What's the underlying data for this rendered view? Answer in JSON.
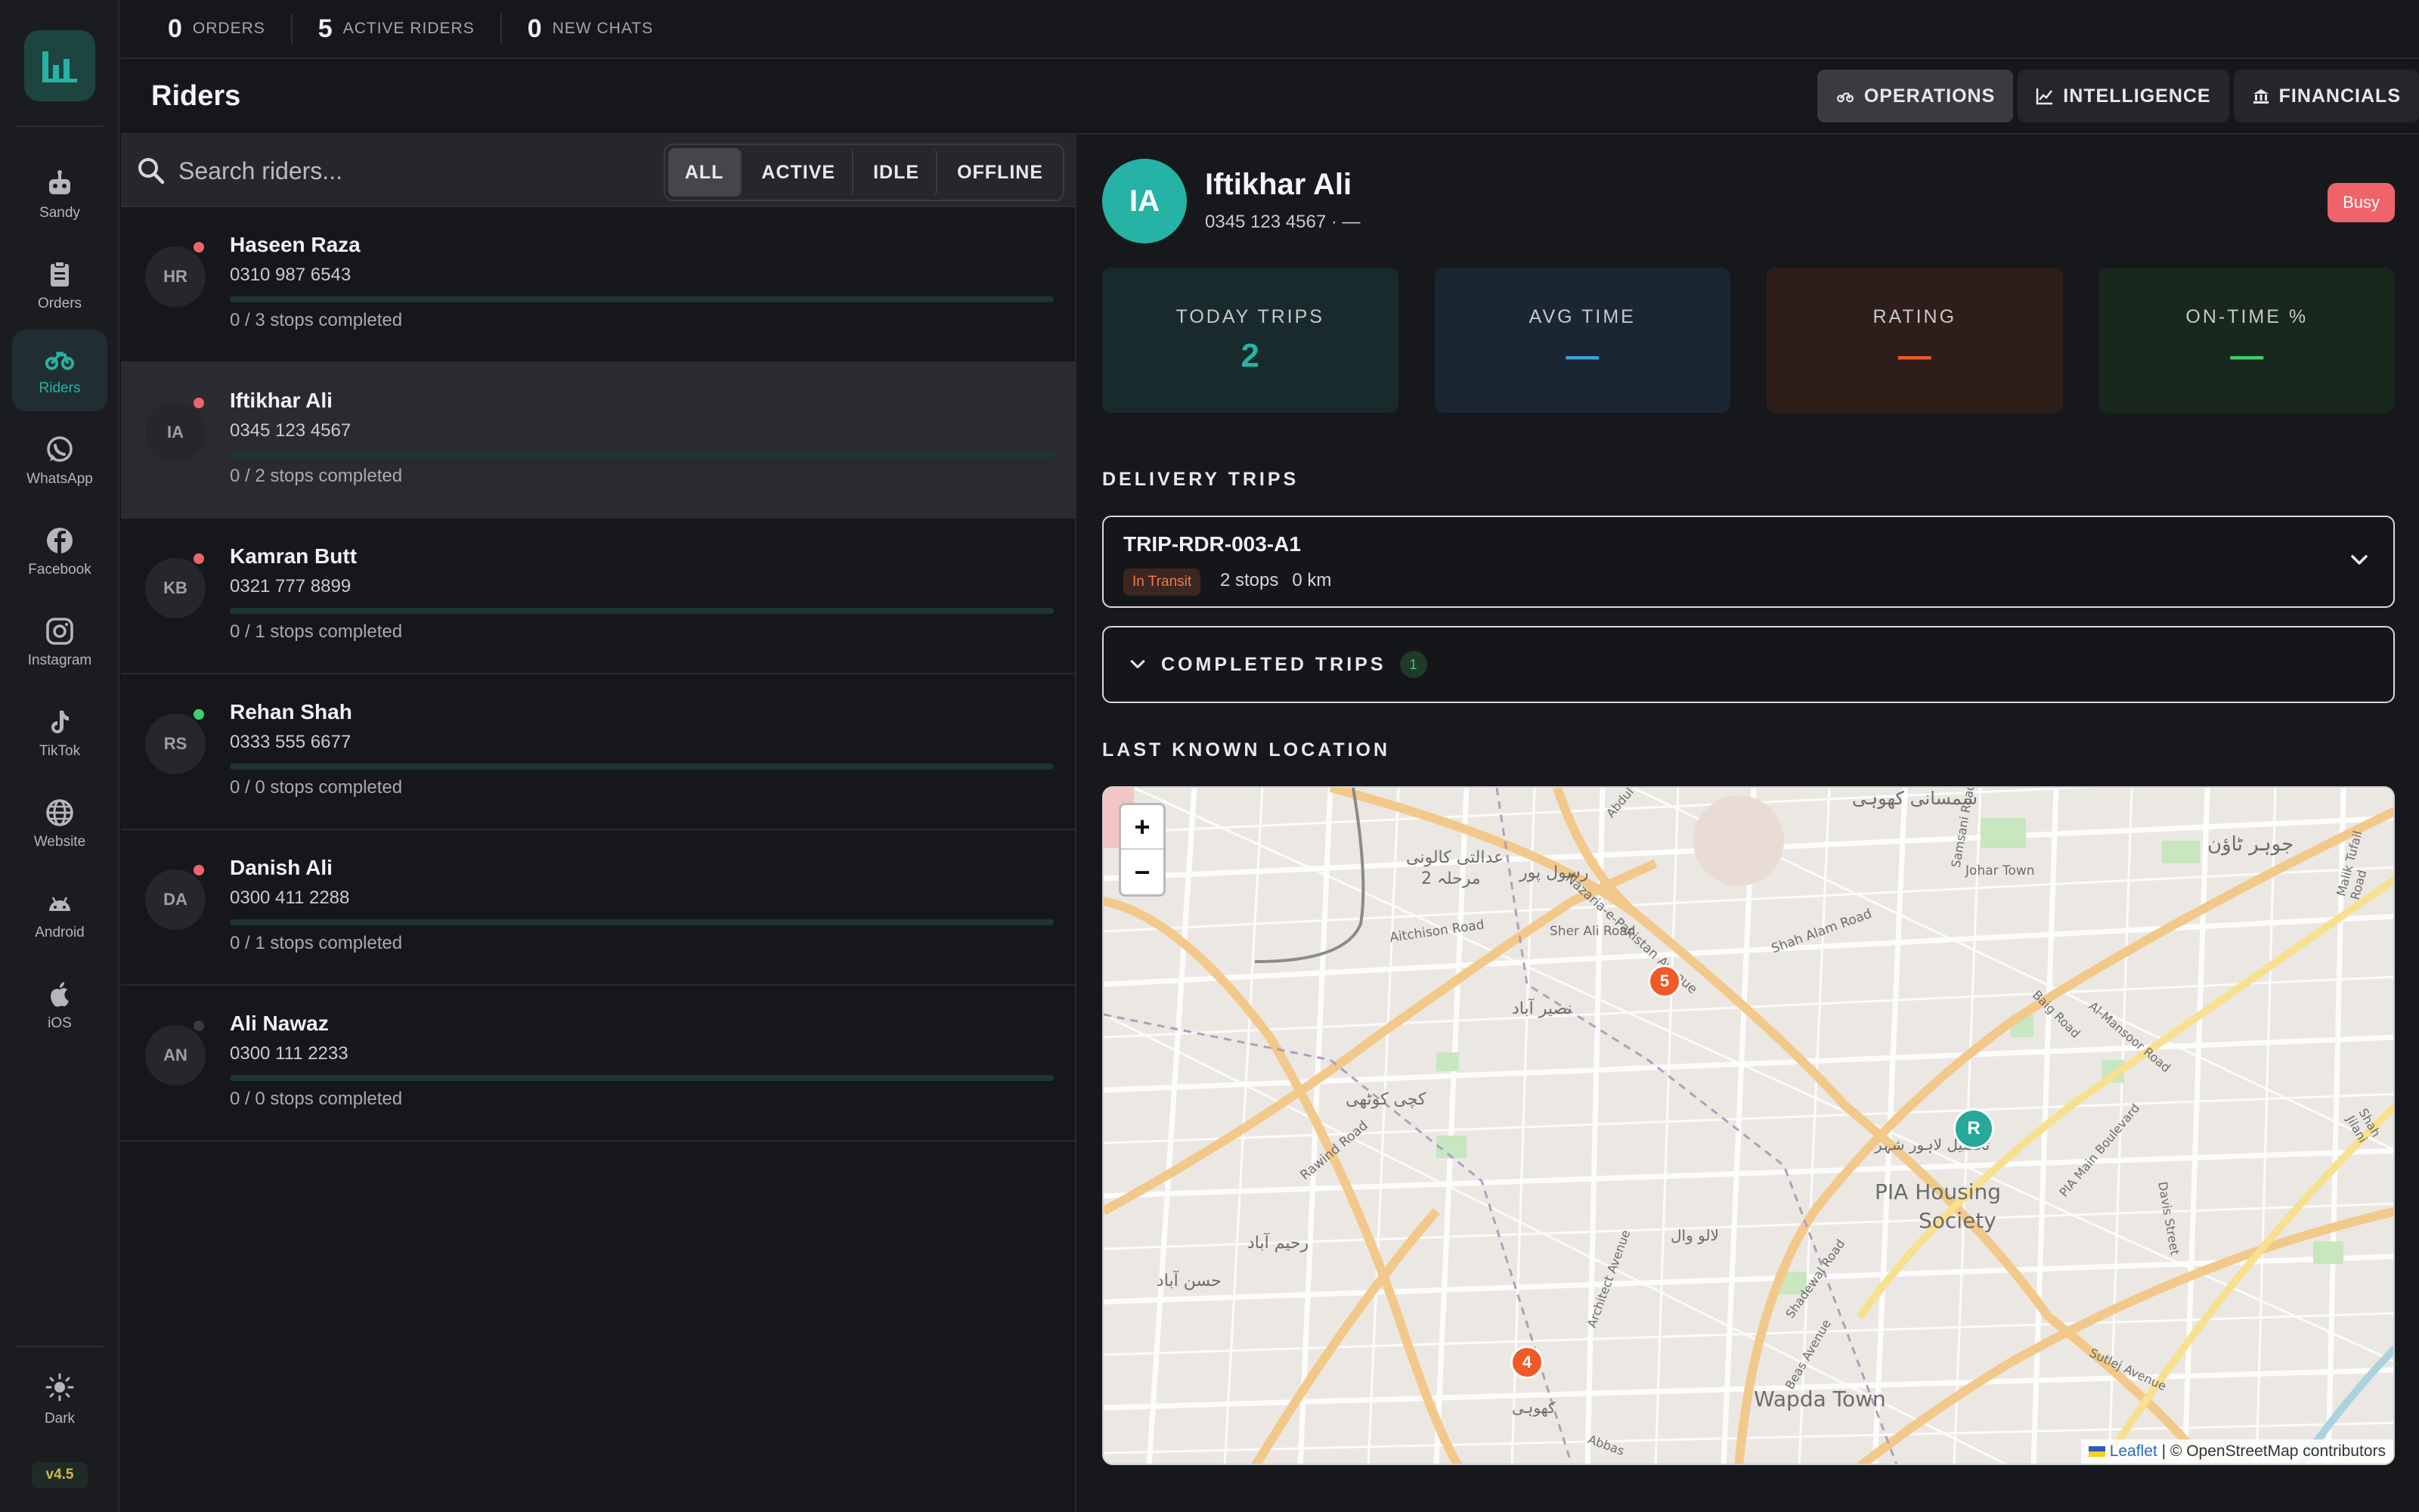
{
  "sidebar": {
    "items": [
      {
        "label": "Sandy",
        "icon": "robot-icon"
      },
      {
        "label": "Orders",
        "icon": "clipboard-icon"
      },
      {
        "label": "Riders",
        "icon": "motorbike-icon"
      },
      {
        "label": "WhatsApp",
        "icon": "whatsapp-icon"
      },
      {
        "label": "Facebook",
        "icon": "facebook-icon"
      },
      {
        "label": "Instagram",
        "icon": "instagram-icon"
      },
      {
        "label": "TikTok",
        "icon": "tiktok-icon"
      },
      {
        "label": "Website",
        "icon": "globe-icon"
      },
      {
        "label": "Android",
        "icon": "android-icon"
      },
      {
        "label": "iOS",
        "icon": "apple-icon"
      }
    ],
    "active": "Riders",
    "theme_label": "Dark",
    "version": "v4.5"
  },
  "topbar": {
    "stats": [
      {
        "value": "0",
        "label": "ORDERS"
      },
      {
        "value": "5",
        "label": "ACTIVE RIDERS"
      },
      {
        "value": "0",
        "label": "NEW CHATS"
      }
    ]
  },
  "header": {
    "title": "Riders",
    "tabs": [
      {
        "label": "OPERATIONS",
        "icon": "motorbike-icon"
      },
      {
        "label": "INTELLIGENCE",
        "icon": "line-chart-icon"
      },
      {
        "label": "FINANCIALS",
        "icon": "bank-icon"
      }
    ],
    "active_tab": "OPERATIONS"
  },
  "riders_list": {
    "search_placeholder": "Search riders...",
    "filters": [
      "ALL",
      "ACTIVE",
      "IDLE",
      "OFFLINE"
    ],
    "active_filter": "ALL",
    "riders": [
      {
        "initials": "HR",
        "name": "Haseen Raza",
        "phone": "0310 987 6543",
        "stops": "0 / 3 stops completed",
        "status": "busy",
        "progress": 0
      },
      {
        "initials": "IA",
        "name": "Iftikhar Ali",
        "phone": "0345 123 4567",
        "stops": "0 / 2 stops completed",
        "status": "busy",
        "progress": 0
      },
      {
        "initials": "KB",
        "name": "Kamran Butt",
        "phone": "0321 777 8899",
        "stops": "0 / 1 stops completed",
        "status": "busy",
        "progress": 0
      },
      {
        "initials": "RS",
        "name": "Rehan Shah",
        "phone": "0333 555 6677",
        "stops": "0 / 0 stops completed",
        "status": "active",
        "progress": 0
      },
      {
        "initials": "DA",
        "name": "Danish Ali",
        "phone": "0300 411 2288",
        "stops": "0 / 1 stops completed",
        "status": "busy",
        "progress": 0
      },
      {
        "initials": "AN",
        "name": "Ali Nawaz",
        "phone": "0300 111 2233",
        "stops": "0 / 0 stops completed",
        "status": "offline",
        "progress": 0
      }
    ],
    "selected_index": 1
  },
  "detail": {
    "initials": "IA",
    "name": "Iftikhar Ali",
    "phone_line": "0345 123 4567 · —",
    "status_badge": "Busy",
    "kpis": [
      {
        "label": "TODAY TRIPS",
        "value": "2",
        "color": "#26b3a5",
        "bg": "#182a2c"
      },
      {
        "label": "AVG TIME",
        "value": "—",
        "color": "#3ea2e0",
        "bg": "#1a2733"
      },
      {
        "label": "RATING",
        "value": "—",
        "color": "#f05a28",
        "bg": "#2e1e19"
      },
      {
        "label": "ON-TIME %",
        "value": "—",
        "color": "#3fcf6a",
        "bg": "#18281d"
      }
    ],
    "delivery_trips_title": "DELIVERY TRIPS",
    "trip": {
      "id": "TRIP-RDR-003-A1",
      "badge": "In Transit",
      "stops": "2 stops",
      "distance": "0 km"
    },
    "completed_trips": {
      "label": "COMPLETED TRIPS",
      "count": "1"
    },
    "location_title": "LAST KNOWN LOCATION",
    "map": {
      "markers": [
        {
          "label": "5",
          "color": "#f05a28"
        },
        {
          "label": "R",
          "color": "#26a89b"
        },
        {
          "label": "4",
          "color": "#f05a28"
        }
      ],
      "place_labels": [
        "PIA Housing",
        "Society",
        "Wapda Town",
        "Nazaria-e-Pakistan Avenue",
        "Shah Alam Road",
        "Johar Town",
        "Sher Ali Road",
        "Aitchison Road",
        "Rawind Road",
        "Architect Avenue",
        "Shadewal Road",
        "Sutlej Avenue",
        "Davis Street",
        "PIA Main Boulevard",
        "Baig Road",
        "Al-Mansoor Road",
        "Malik Tufail Road",
        "Shah Jilani",
        "Beas Avenue",
        "Samsani Road",
        "Abdul",
        "Abbas"
      ],
      "urdu_labels": [
        "عدالتی کالونی",
        "مرحلہ 2",
        "رسول پور",
        "سمسانی کھوہی",
        "جوہر ٹاؤن",
        "نصیر آباد",
        "کچی کوٹھی",
        "رحیم آباد",
        "حسن آباد",
        "لالو وال",
        "تحصیل لاہور شہر",
        "کھوہی"
      ],
      "zoom_in": "+",
      "zoom_out": "−",
      "attribution_link": "Leaflet",
      "attribution_text": "| © OpenStreetMap contributors"
    }
  }
}
